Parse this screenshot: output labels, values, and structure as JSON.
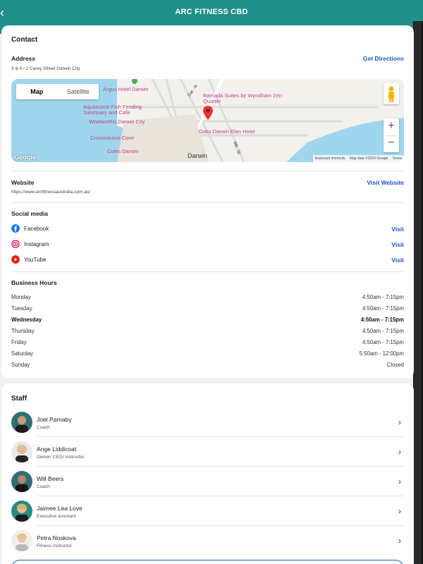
{
  "header": {
    "title": "ARC FITNESS CBD",
    "back_icon": "chevron-left-icon"
  },
  "contact": {
    "section_title": "Contact",
    "address_label": "Address",
    "address_value": "3 & 4 / 1 Carey Street Darwin City",
    "get_directions": "Get Directions",
    "map": {
      "map_tab": "Map",
      "satellite_tab": "Satellite",
      "labels": [
        "Argus Hotel Darwin",
        "Aquascene Fish Feeding Sanctuary and Cafe",
        "Woolworths Darwin City",
        "Crocosaurus Cove",
        "Coles Darwin",
        "Ramada Suites by Wyndham Zen Quarter",
        "Oaks Darwin Elan Hotel",
        "Darwin",
        "Gar...la",
        "Mit...St"
      ],
      "footer": [
        "Keyboard shortcuts",
        "Map data ©2024 Google",
        "Terms"
      ],
      "logo": "Google",
      "zoom_in": "+",
      "zoom_out": "−"
    },
    "website_label": "Website",
    "website_value": "https://www.arcfitnessaustralia.com.au/",
    "visit_website": "Visit Website",
    "social_label": "Social media",
    "social": [
      {
        "name": "Facebook",
        "action": "Visit",
        "icon": "facebook-icon",
        "color": "#1877f2"
      },
      {
        "name": "Instagram",
        "action": "Visit",
        "icon": "instagram-icon",
        "color": "#d62976"
      },
      {
        "name": "YouTube",
        "action": "Visit",
        "icon": "youtube-icon",
        "color": "#e62117"
      }
    ],
    "hours_label": "Business Hours",
    "hours": [
      {
        "day": "Monday",
        "time": "4:50am - 7:15pm",
        "today": false
      },
      {
        "day": "Tuesday",
        "time": "4:50am - 7:15pm",
        "today": false
      },
      {
        "day": "Wednesday",
        "time": "4:50am - 7:15pm",
        "today": true
      },
      {
        "day": "Thursday",
        "time": "4:50am - 7:15pm",
        "today": false
      },
      {
        "day": "Friday",
        "time": "4:50am - 7:15pm",
        "today": false
      },
      {
        "day": "Saturday",
        "time": "5:50am - 12:00pm",
        "today": false
      },
      {
        "day": "Sunday",
        "time": "Closed",
        "today": false
      }
    ]
  },
  "staff": {
    "section_title": "Staff",
    "members": [
      {
        "name": "Joel Parnaby",
        "role": "Coach"
      },
      {
        "name": "Ange Liddicoat",
        "role": "Owner/ CEO/ Instructor"
      },
      {
        "name": "Will Beers",
        "role": "Coach"
      },
      {
        "name": "Jaimee Lea Love",
        "role": "Executive assistant"
      },
      {
        "name": "Petra Noskova",
        "role": "Fitness Instructor"
      }
    ]
  },
  "colors": {
    "header": "#1f8f88",
    "link": "#1a56c9",
    "accent_pink": "#c2418c",
    "map_water": "#9fd6ee"
  }
}
